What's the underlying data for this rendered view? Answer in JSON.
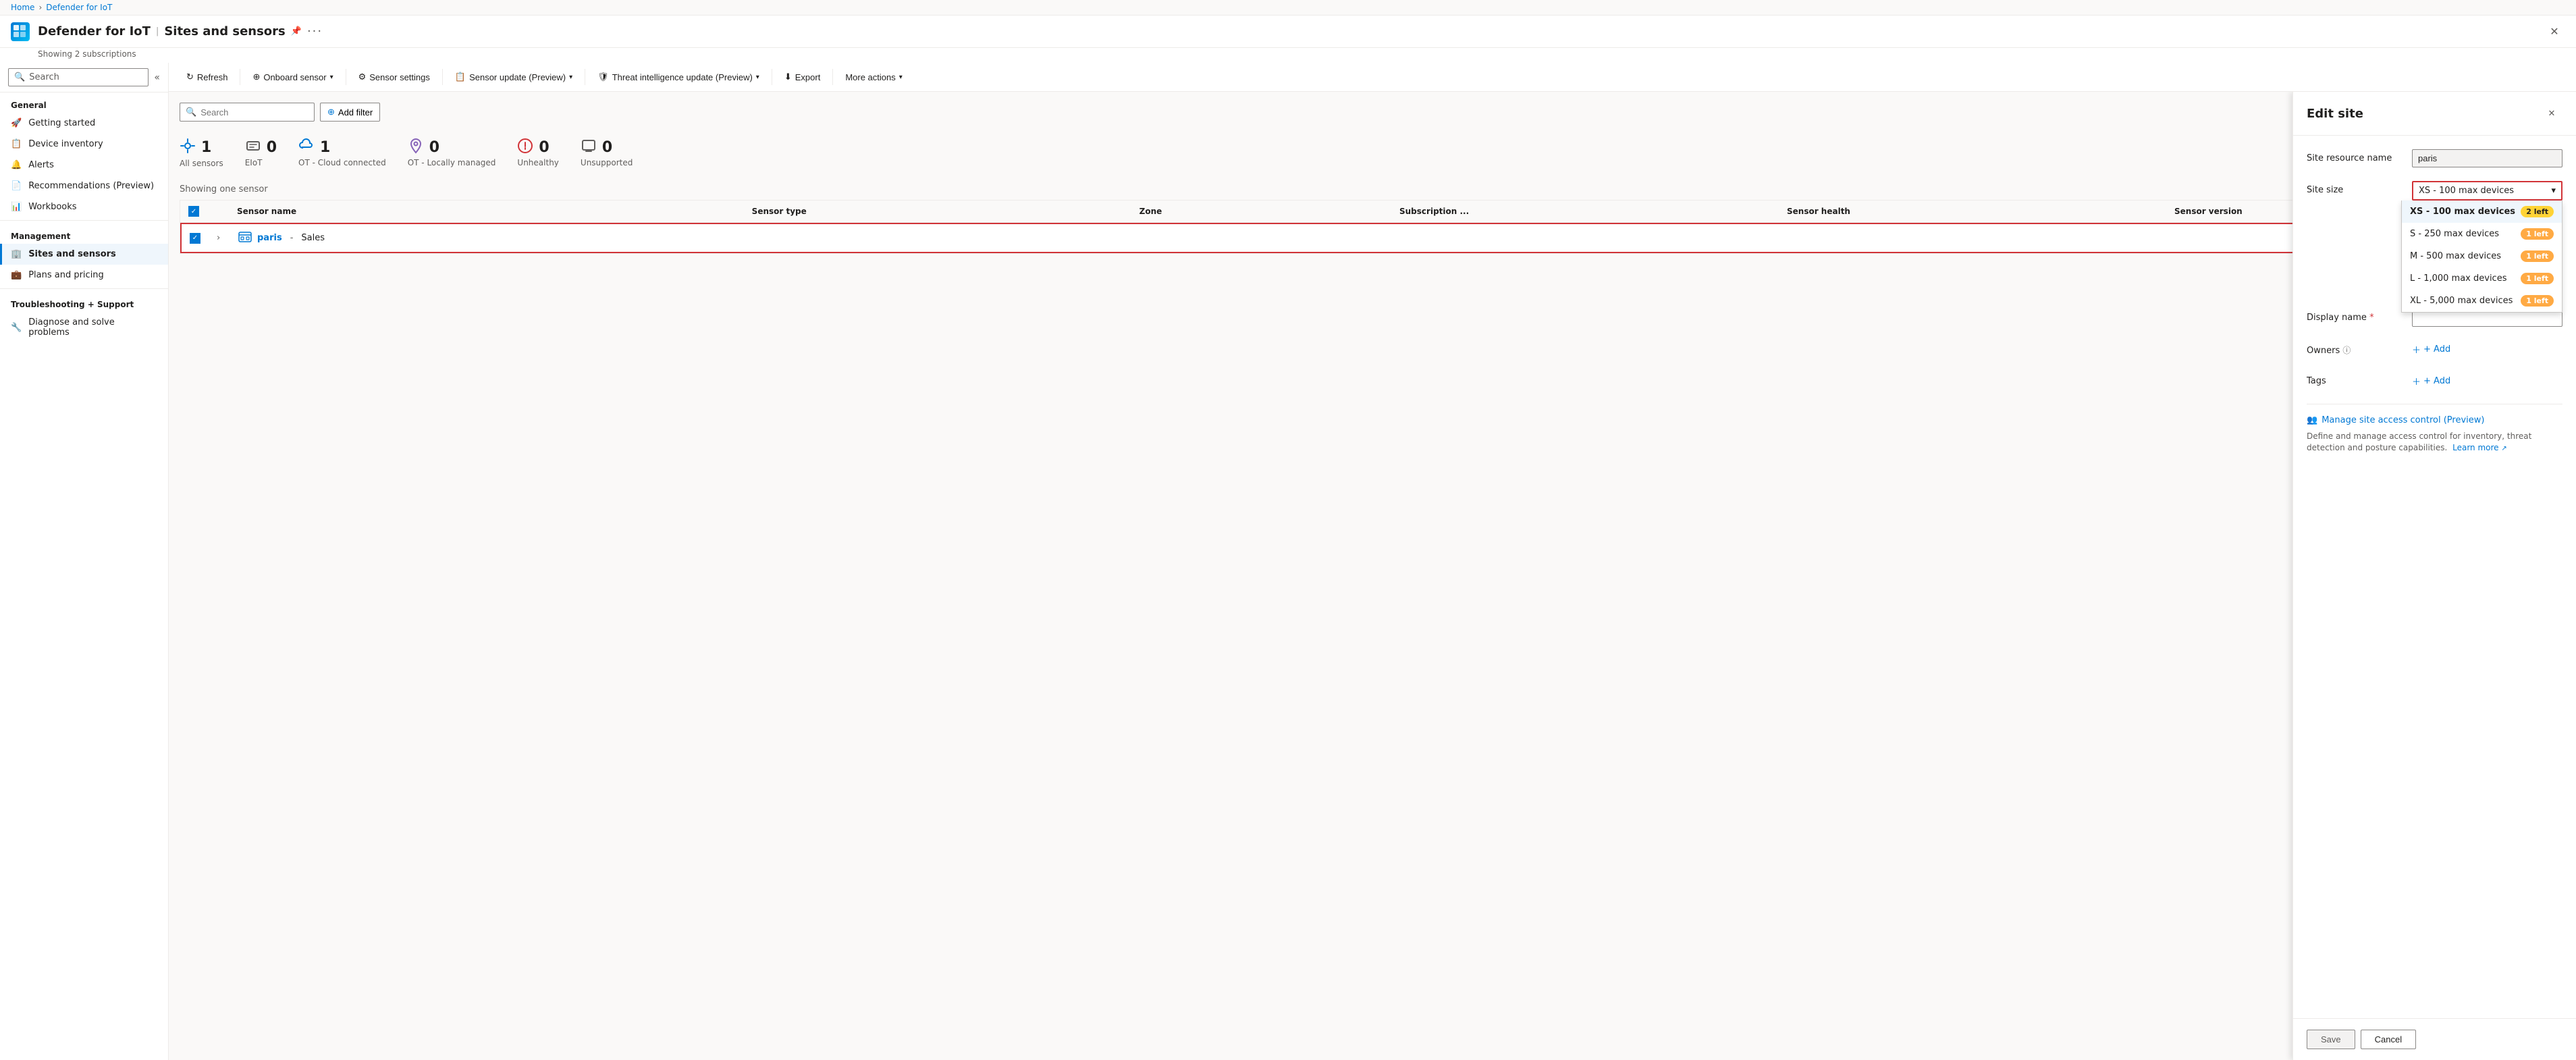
{
  "breadcrumb": {
    "home": "Home",
    "section": "Defender for IoT"
  },
  "header": {
    "app_icon": "🔷",
    "title": "Defender for IoT",
    "separator": "|",
    "subtitle": "Sites and sensors",
    "showing": "Showing 2 subscriptions",
    "pin_icon": "📌",
    "more_icon": "···",
    "close_icon": "✕"
  },
  "sidebar": {
    "search_placeholder": "Search",
    "collapse_icon": "«",
    "general_label": "General",
    "items_general": [
      {
        "id": "getting-started",
        "label": "Getting started",
        "icon": "🚀"
      },
      {
        "id": "device-inventory",
        "label": "Device inventory",
        "icon": "📋"
      },
      {
        "id": "alerts",
        "label": "Alerts",
        "icon": "🔔"
      },
      {
        "id": "recommendations",
        "label": "Recommendations (Preview)",
        "icon": "📄"
      },
      {
        "id": "workbooks",
        "label": "Workbooks",
        "icon": "📊"
      }
    ],
    "management_label": "Management",
    "items_management": [
      {
        "id": "sites-sensors",
        "label": "Sites and sensors",
        "icon": "🏢",
        "active": true
      },
      {
        "id": "plans-pricing",
        "label": "Plans and pricing",
        "icon": "💼"
      }
    ],
    "support_label": "Troubleshooting + Support",
    "items_support": [
      {
        "id": "diagnose",
        "label": "Diagnose and solve problems",
        "icon": "🔧"
      }
    ]
  },
  "toolbar": {
    "refresh_label": "Refresh",
    "onboard_label": "Onboard sensor",
    "settings_label": "Sensor settings",
    "update_label": "Sensor update (Preview)",
    "threat_label": "Threat intelligence update (Preview)",
    "export_label": "Export",
    "more_label": "More actions"
  },
  "filter": {
    "search_placeholder": "Search",
    "add_filter_label": "Add filter",
    "add_filter_icon": "⊕"
  },
  "stats": [
    {
      "id": "all-sensors",
      "icon": "📶",
      "count": "1",
      "label": "All sensors"
    },
    {
      "id": "elot",
      "icon": "🏢",
      "count": "0",
      "label": "EIoT"
    },
    {
      "id": "ot-cloud",
      "icon": "🔗",
      "count": "1",
      "label": "OT - Cloud connected"
    },
    {
      "id": "ot-local",
      "icon": "📍",
      "count": "0",
      "label": "OT - Locally managed"
    },
    {
      "id": "unhealthy",
      "icon": "💔",
      "count": "0",
      "label": "Unhealthy"
    },
    {
      "id": "unsupported",
      "icon": "🏛",
      "count": "0",
      "label": "Unsupported"
    }
  ],
  "table": {
    "showing_label": "Showing one sensor",
    "columns": [
      "Sensor name",
      "Sensor type",
      "Zone",
      "Subscription ...",
      "Sensor health",
      "Sensor version"
    ],
    "site_row": {
      "site_name": "paris",
      "site_dash": "-",
      "site_zone": "Sales",
      "icon": "🏢"
    }
  },
  "edit_panel": {
    "title": "Edit site",
    "close_icon": "✕",
    "resource_name_label": "Site resource name",
    "resource_name_value": "paris",
    "site_size_label": "Site size",
    "display_name_label": "Display name",
    "display_name_required": true,
    "owners_label": "Owners",
    "tags_label": "Tags",
    "selected_size": "XS - 100 max devices",
    "size_options": [
      {
        "id": "xs",
        "label": "XS - 100 max devices",
        "badge": "2 left",
        "badge_color": "yellow",
        "selected": true
      },
      {
        "id": "s",
        "label": "S - 250 max devices",
        "badge": "1 left",
        "badge_color": "orange"
      },
      {
        "id": "m",
        "label": "M - 500 max devices",
        "badge": "1 left",
        "badge_color": "orange"
      },
      {
        "id": "l",
        "label": "L - 1,000 max devices",
        "badge": "1 left",
        "badge_color": "orange"
      },
      {
        "id": "xl",
        "label": "XL - 5,000 max devices",
        "badge": "1 left",
        "badge_color": "orange"
      }
    ],
    "add_label": "+ Add",
    "manage_link": "Manage site access control (Preview)",
    "manage_desc": "Define and manage access control for inventory, threat detection and posture capabilities.",
    "learn_more": "Learn more",
    "save_label": "Save",
    "cancel_label": "Cancel"
  }
}
